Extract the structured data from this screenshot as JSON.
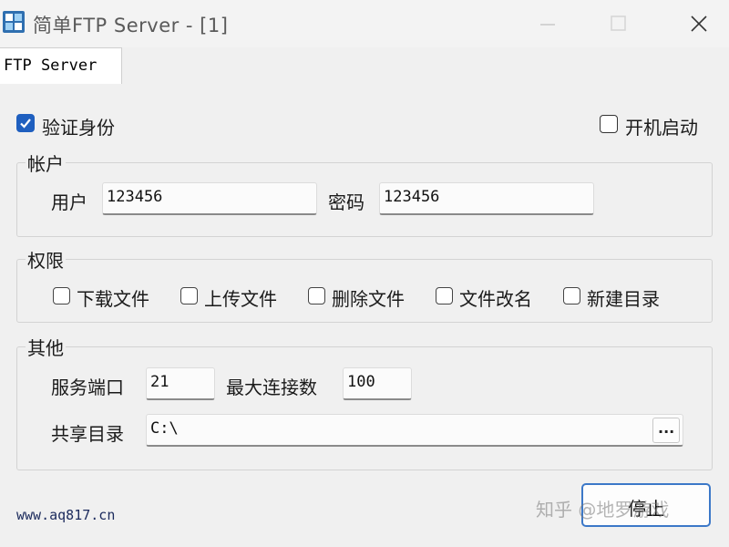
{
  "window": {
    "title": "简单FTP Server - [1]",
    "icon": "app-logo-icon",
    "controls": [
      "minimize-icon",
      "maximize-icon",
      "close-icon"
    ]
  },
  "tabs": [
    {
      "label": "FTP Server",
      "active": true
    }
  ],
  "options": {
    "verify_identity": {
      "label": "验证身份",
      "checked": true
    },
    "start_on_boot": {
      "label": "开机启动",
      "checked": false
    }
  },
  "account": {
    "group_title": "帐户",
    "user_label": "用户",
    "user_value": "123456",
    "password_label": "密码",
    "password_value": "123456"
  },
  "permissions": {
    "group_title": "权限",
    "items": [
      {
        "label": "下载文件",
        "checked": false
      },
      {
        "label": "上传文件",
        "checked": false
      },
      {
        "label": "删除文件",
        "checked": false
      },
      {
        "label": "文件改名",
        "checked": false
      },
      {
        "label": "新建目录",
        "checked": false
      }
    ]
  },
  "other": {
    "group_title": "其他",
    "port_label": "服务端口",
    "port_value": "21",
    "max_conn_label": "最大连接数",
    "max_conn_value": "100",
    "share_dir_label": "共享目录",
    "share_dir_value": "C:\\",
    "browse_label": "..."
  },
  "footer": {
    "site": "www.aq817.cn",
    "stop_label": "停止",
    "watermark": "知乎 @地罗游戏"
  },
  "colors": {
    "accent": "#1f5fbf",
    "button_border": "#3c78c8"
  }
}
